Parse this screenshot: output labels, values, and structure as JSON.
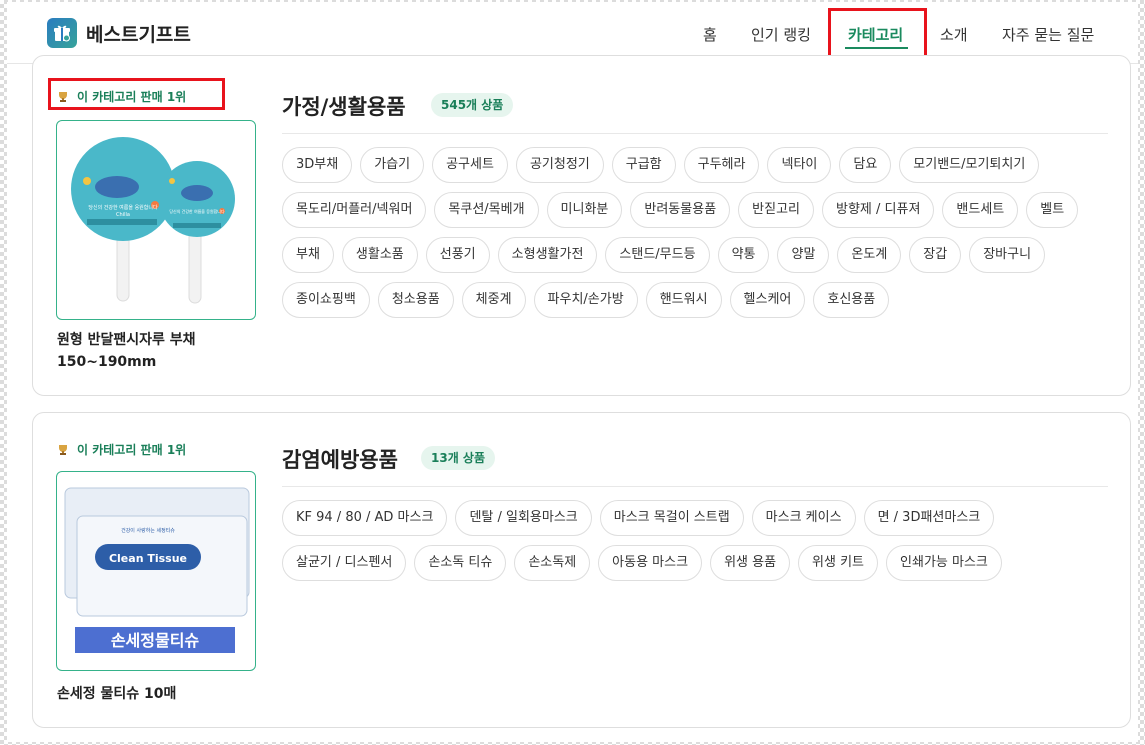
{
  "header": {
    "brand": "베스트기프트",
    "nav": [
      {
        "label": "홈"
      },
      {
        "label": "인기 랭킹"
      },
      {
        "label": "카테고리",
        "active": true
      },
      {
        "label": "소개"
      },
      {
        "label": "자주 묻는 질문"
      }
    ]
  },
  "colors": {
    "accent": "#1a8a5e",
    "highlight": "#e8131c",
    "pill_bg": "#e6f5ee"
  },
  "categories": [
    {
      "top_badge": "이 카테고리 판매 1위",
      "product_name_line1": "원형 반달팬시자루 부채",
      "product_name_line2": "150~190mm",
      "title": "가정/생활용품",
      "count": "545개 상품",
      "image_icon": "round-fan-image",
      "image_text": {
        "fan_caption_large": "당신의 건강한 여름을 응원합니다",
        "fan_caption_small": "당신의 건강한 여름을 응원합니다",
        "fan_brand": "Chilla"
      },
      "tags": [
        "3D부채",
        "가습기",
        "공구세트",
        "공기청정기",
        "구급함",
        "구두헤라",
        "넥타이",
        "담요",
        "모기밴드/모기퇴치기",
        "목도리/머플러/넥워머",
        "목쿠션/목베개",
        "미니화분",
        "반려동물용품",
        "반짇고리",
        "방향제 / 디퓨져",
        "밴드세트",
        "벨트",
        "부채",
        "생활소품",
        "선풍기",
        "소형생활가전",
        "스탠드/무드등",
        "약통",
        "양말",
        "온도계",
        "장갑",
        "장바구니",
        "종이쇼핑백",
        "청소용품",
        "체중계",
        "파우치/손가방",
        "핸드워시",
        "헬스케어",
        "호신용품"
      ]
    },
    {
      "top_badge": "이 카테고리 판매 1위",
      "product_name_line1": "손세정 물티슈 10매",
      "title": "감염예방용품",
      "count": "13개 상품",
      "image_icon": "wet-tissue-image",
      "image_text": {
        "pack_label": "Clean Tissue",
        "pack_header": "건강이 사랑하는 세정티슈",
        "banner": "손세정물티슈"
      },
      "tags": [
        "KF 94 / 80 / AD 마스크",
        "덴탈 / 일회용마스크",
        "마스크 목걸이 스트랩",
        "마스크 케이스",
        "면 / 3D패션마스크",
        "살균기 / 디스펜서",
        "손소독 티슈",
        "손소독제",
        "아동용 마스크",
        "위생 용품",
        "위생 키트",
        "인쇄가능 마스크"
      ]
    }
  ]
}
